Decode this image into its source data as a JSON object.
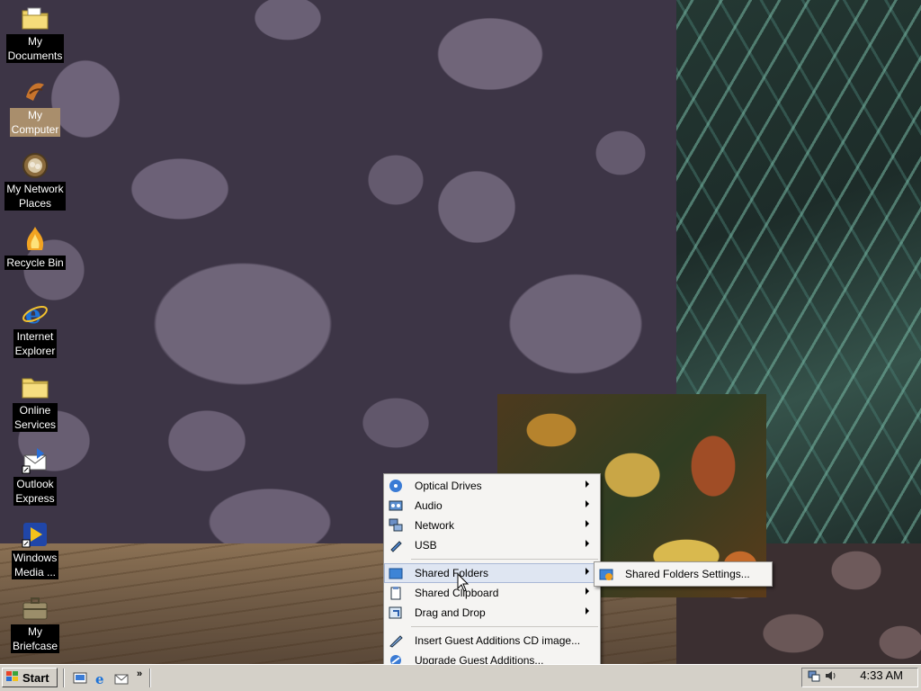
{
  "desktop": {
    "icons": [
      {
        "label": "My\nDocuments",
        "icon": "folder-documents-icon"
      },
      {
        "label": "My\nComputer",
        "icon": "computer-icon",
        "selected": true
      },
      {
        "label": "My Network\nPlaces",
        "icon": "network-places-icon"
      },
      {
        "label": "Recycle Bin",
        "icon": "recycle-bin-icon"
      },
      {
        "label": "Internet\nExplorer",
        "icon": "internet-explorer-icon"
      },
      {
        "label": "Online\nServices",
        "icon": "folder-icon"
      },
      {
        "label": "Outlook\nExpress",
        "icon": "outlook-express-icon"
      },
      {
        "label": "Windows\nMedia ...",
        "icon": "windows-media-icon"
      },
      {
        "label": "My\nBriefcase",
        "icon": "briefcase-icon"
      }
    ]
  },
  "menu": {
    "items": [
      {
        "label": "Optical Drives",
        "icon": "optical-drive-icon",
        "submenu": true
      },
      {
        "label": "Audio",
        "icon": "audio-icon",
        "submenu": true
      },
      {
        "label": "Network",
        "icon": "network-icon",
        "submenu": true
      },
      {
        "label": "USB",
        "icon": "usb-icon",
        "submenu": true
      },
      {
        "label": "Shared Folders",
        "icon": "shared-folder-icon",
        "submenu": true,
        "highlighted": true
      },
      {
        "label": "Shared Clipboard",
        "icon": "clipboard-icon",
        "submenu": true
      },
      {
        "label": "Drag and Drop",
        "icon": "drag-drop-icon",
        "submenu": true
      },
      {
        "label": "Insert Guest Additions CD image...",
        "icon": "guest-additions-cd-icon"
      },
      {
        "label": "Upgrade Guest Additions...",
        "icon": "upgrade-guest-additions-icon"
      }
    ],
    "submenu": {
      "items": [
        {
          "label": "Shared Folders Settings...",
          "icon": "shared-folder-settings-icon"
        }
      ]
    }
  },
  "taskbar": {
    "start_label": "Start",
    "quick_launch": [
      "show-desktop-icon",
      "internet-explorer-icon",
      "outlook-express-icon"
    ],
    "chevron": "»",
    "clock": "4:33 AM",
    "tray_icons": [
      "network-tray-icon",
      "volume-icon"
    ]
  },
  "colors": {
    "taskbar": "#d4d0c8",
    "menu_bg": "#f5f4f2",
    "menu_highlight": "#dfe6f2",
    "selection": "#a98e6c"
  }
}
